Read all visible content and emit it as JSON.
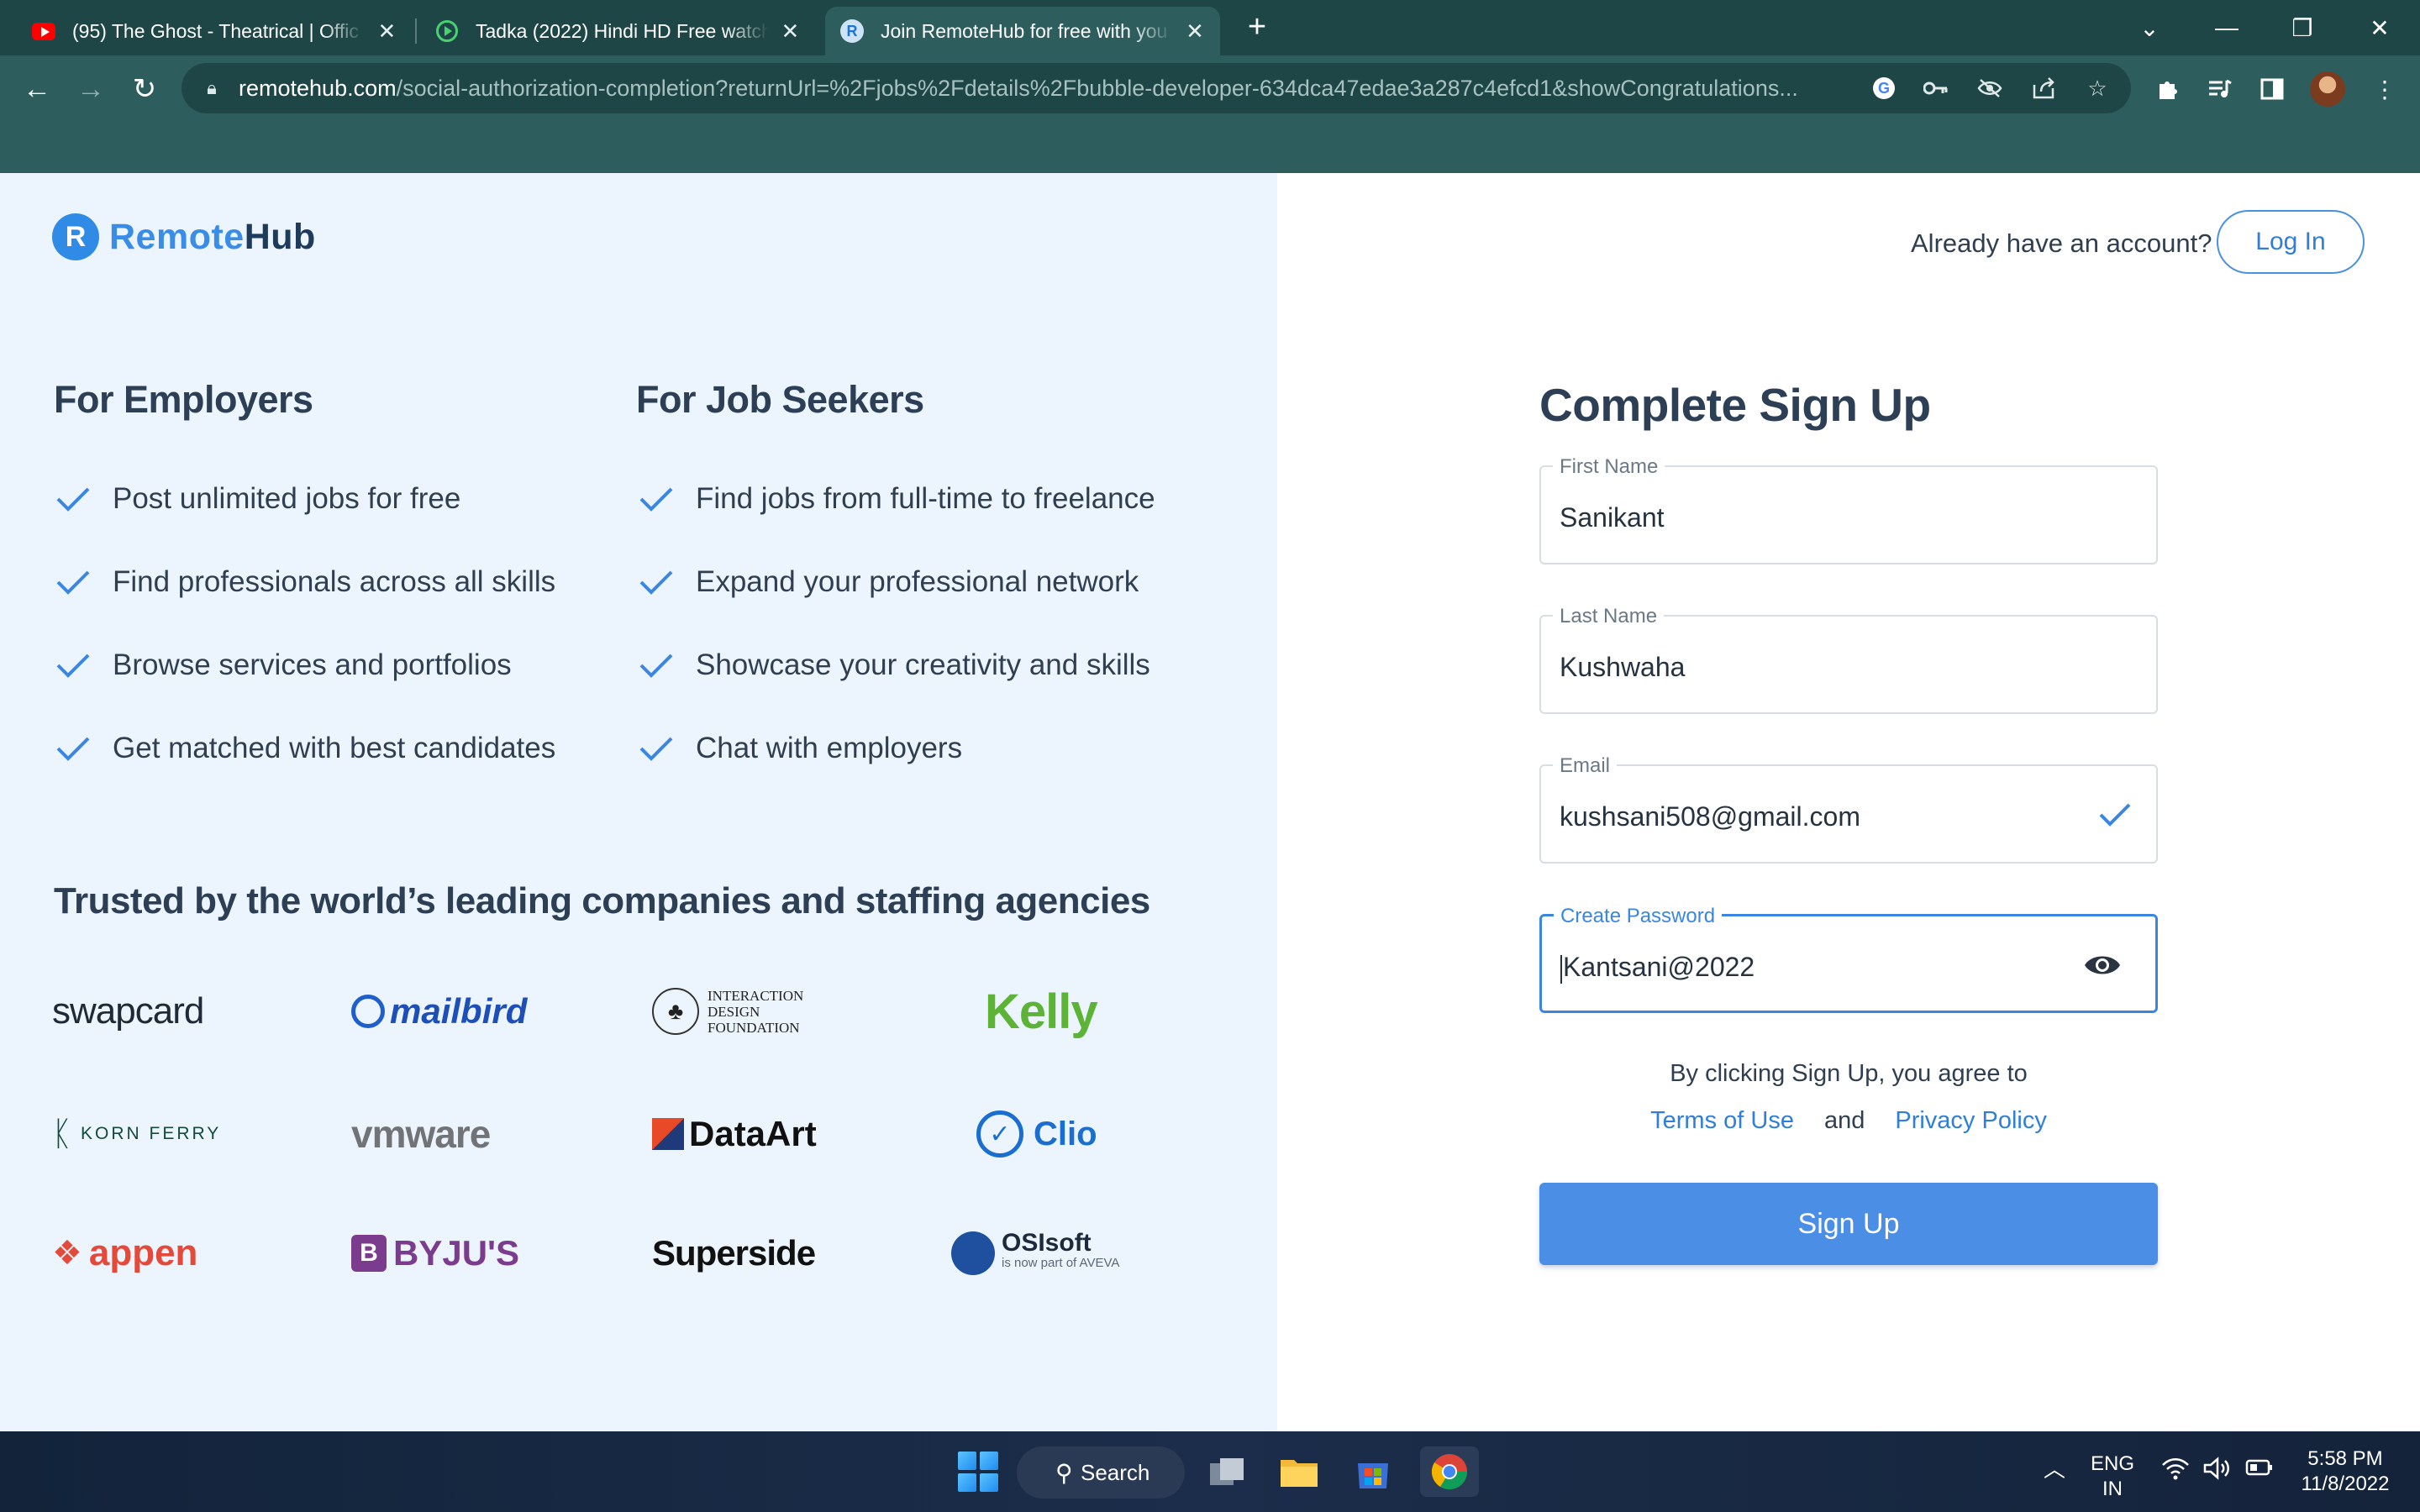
{
  "browser": {
    "tabs": [
      {
        "title": "(95) The Ghost - Theatrical | Offic",
        "favicon": "youtube-icon"
      },
      {
        "title": "Tadka (2022) Hindi HD Free watch",
        "favicon": "play-icon"
      },
      {
        "title": "Join RemoteHub for free with you",
        "favicon": "remotehub-icon",
        "active": true
      }
    ],
    "url_domain": "remotehub.com",
    "url_path": "/social-authorization-completion?returnUrl=%2Fjobs%2Fdetails%2Fbubble-developer-634dca47edae3a287c4efcd1&showCongratulations..."
  },
  "brand": {
    "name_a": "Remote",
    "name_b": "Hub",
    "color": "#3a8de6"
  },
  "employers": {
    "title": "For Employers",
    "items": [
      "Post unlimited jobs for free",
      "Find professionals across all skills",
      "Browse services and portfolios",
      "Get matched with best candidates"
    ]
  },
  "seekers": {
    "title": "For Job Seekers",
    "items": [
      "Find jobs from full-time to freelance",
      "Expand your professional network",
      "Showcase your creativity and skills",
      "Chat with employers"
    ]
  },
  "trusted": {
    "title": "Trusted by the world’s leading companies and staffing agencies",
    "logos": [
      "swapcard",
      "mailbird",
      "INTERACTION DESIGN FOUNDATION",
      "Kelly",
      "KORN FERRY",
      "vmware",
      "DataArt",
      "Clio",
      "appen",
      "BYJU'S",
      "Superside",
      "OSIsoft",
      "is now part of AVEVA"
    ]
  },
  "header": {
    "question": "Already have an account?",
    "login": "Log In"
  },
  "form": {
    "title": "Complete Sign Up",
    "first_name": {
      "label": "First Name",
      "value": "Sanikant"
    },
    "last_name": {
      "label": "Last Name",
      "value": "Kushwaha"
    },
    "email": {
      "label": "Email",
      "value": "kushsani508@gmail.com"
    },
    "password": {
      "label": "Create Password",
      "value": "Kantsani@2022"
    },
    "agree_text": "By clicking Sign Up, you agree to",
    "terms": "Terms of Use",
    "and": "and",
    "privacy": "Privacy Policy",
    "submit": "Sign Up",
    "accent": "#4a8ee6"
  },
  "taskbar": {
    "search": "Search",
    "lang_1": "ENG",
    "lang_2": "IN",
    "time": "5:58 PM",
    "date": "11/8/2022"
  }
}
